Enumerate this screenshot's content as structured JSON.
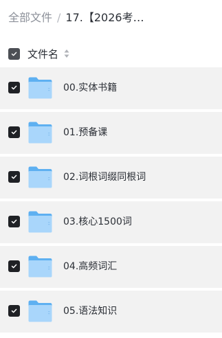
{
  "breadcrumb": {
    "root": "全部文件",
    "separator": "/",
    "current": "17.【2026考…"
  },
  "header": {
    "column_label": "文件名",
    "select_all_checked": true
  },
  "rows": [
    {
      "name": "00.实体书籍",
      "checked": true,
      "icon": "folder-icon"
    },
    {
      "name": "01.预备课",
      "checked": true,
      "icon": "folder-icon"
    },
    {
      "name": "02.词根词缀同根词",
      "checked": true,
      "icon": "folder-icon"
    },
    {
      "name": "03.核心1500词",
      "checked": true,
      "icon": "folder-icon"
    },
    {
      "name": "04.高频词汇",
      "checked": true,
      "icon": "folder-icon"
    },
    {
      "name": "05.语法知识",
      "checked": true,
      "icon": "folder-icon"
    }
  ],
  "colors": {
    "row_background": "#f2f2f2",
    "checkbox": "#1f2125",
    "folder_light": "#a9d6fb",
    "folder_dark": "#5eb0f1"
  }
}
